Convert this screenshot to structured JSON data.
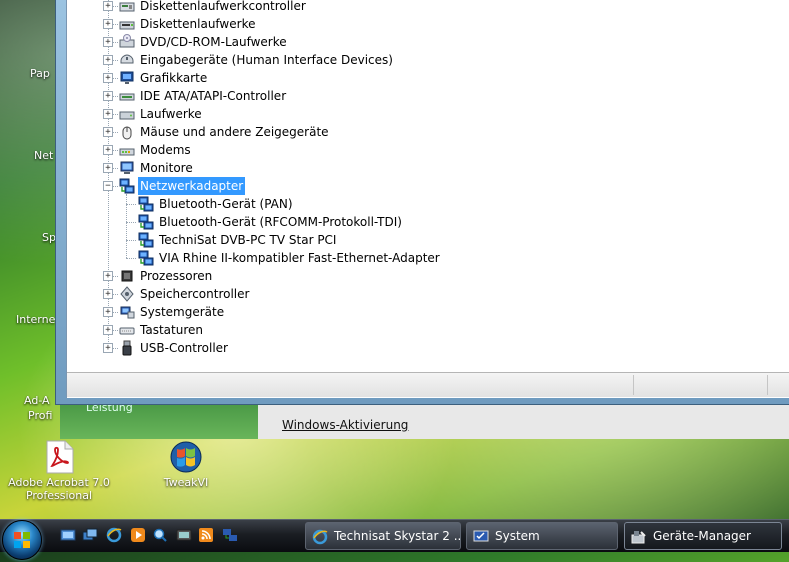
{
  "desktop": {
    "icons": [
      {
        "label": "Adobe Acrobat 7.0\nProfessional"
      },
      {
        "label": "TweakVI"
      }
    ],
    "clipped_labels": [
      "Pap",
      "Net",
      "Sp",
      "Interne",
      "Ad-A",
      "Profi"
    ]
  },
  "device_manager": {
    "categories": [
      {
        "label": "Diskettenlaufwerkcontroller",
        "icon": "floppy-controller-icon",
        "expanded": false
      },
      {
        "label": "Diskettenlaufwerke",
        "icon": "floppy-drive-icon",
        "expanded": false
      },
      {
        "label": "DVD/CD-ROM-Laufwerke",
        "icon": "dvd-drive-icon",
        "expanded": false
      },
      {
        "label": "Eingabegeräte (Human Interface Devices)",
        "icon": "hid-icon",
        "expanded": false
      },
      {
        "label": "Grafikkarte",
        "icon": "display-adapter-icon",
        "expanded": false
      },
      {
        "label": "IDE ATA/ATAPI-Controller",
        "icon": "ide-controller-icon",
        "expanded": false
      },
      {
        "label": "Laufwerke",
        "icon": "disk-drive-icon",
        "expanded": false
      },
      {
        "label": "Mäuse und andere Zeigegeräte",
        "icon": "mouse-icon",
        "expanded": false
      },
      {
        "label": "Modems",
        "icon": "modem-icon",
        "expanded": false
      },
      {
        "label": "Monitore",
        "icon": "monitor-icon",
        "expanded": false
      },
      {
        "label": "Netzwerkadapter",
        "icon": "network-adapter-icon",
        "expanded": true,
        "selected": true,
        "children": [
          {
            "label": "Bluetooth-Gerät (PAN)",
            "icon": "network-adapter-icon"
          },
          {
            "label": "Bluetooth-Gerät (RFCOMM-Protokoll-TDI)",
            "icon": "network-adapter-icon"
          },
          {
            "label": "TechniSat DVB-PC TV Star PCI",
            "icon": "network-adapter-icon"
          },
          {
            "label": "VIA Rhine II-kompatibler Fast-Ethernet-Adapter",
            "icon": "network-adapter-icon"
          }
        ]
      },
      {
        "label": "Prozessoren",
        "icon": "processor-icon",
        "expanded": false
      },
      {
        "label": "Speichercontroller",
        "icon": "storage-controller-icon",
        "expanded": false
      },
      {
        "label": "Systemgeräte",
        "icon": "system-device-icon",
        "expanded": false
      },
      {
        "label": "Tastaturen",
        "icon": "keyboard-icon",
        "expanded": false
      },
      {
        "label": "USB-Controller",
        "icon": "usb-icon",
        "expanded": false
      }
    ]
  },
  "background_window": {
    "left_label": "Leistung",
    "activation_link": "Windows-Aktivierung"
  },
  "taskbar": {
    "quick_launch": [
      "show-desktop-icon",
      "switch-windows-icon",
      "internet-explorer-icon",
      "media-player-icon",
      "search-icon",
      "tv-icon",
      "rss-icon",
      "network-icon"
    ],
    "buttons": [
      {
        "label": "Technisat Skystar 2 ...",
        "icon": "internet-explorer-icon",
        "active": false
      },
      {
        "label": "System",
        "icon": "system-icon",
        "active": false
      },
      {
        "label": "Geräte-Manager",
        "icon": "device-manager-icon",
        "active": true
      }
    ]
  },
  "colors": {
    "selection": "#3399ff",
    "taskbar": "#1a1d22"
  }
}
